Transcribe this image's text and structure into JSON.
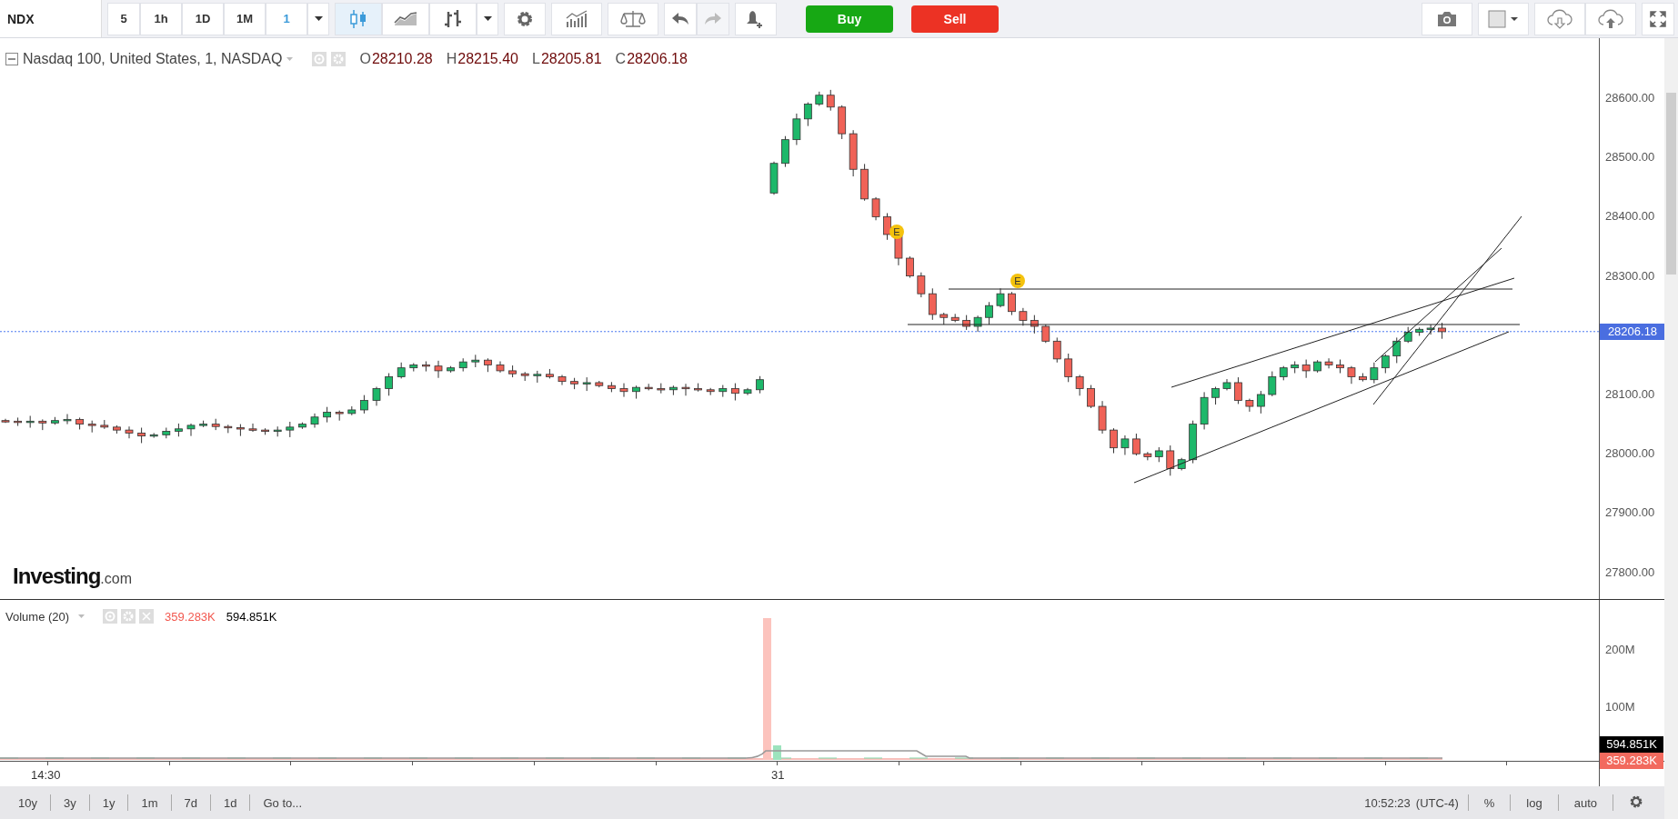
{
  "toolbar": {
    "symbol": "NDX",
    "intervals": [
      {
        "label": "5",
        "selected": false
      },
      {
        "label": "1h",
        "selected": false
      },
      {
        "label": "1D",
        "selected": false
      },
      {
        "label": "1M",
        "selected": false
      },
      {
        "label": "1",
        "selected": true
      }
    ],
    "chart_types": [
      {
        "kind": "candles",
        "selected": true
      },
      {
        "kind": "line",
        "selected": false
      },
      {
        "kind": "bars",
        "selected": false
      }
    ],
    "buy": "Buy",
    "sell": "Sell"
  },
  "legend": {
    "title": "Nasdaq 100, United States, 1, NASDAQ",
    "ohlc": [
      {
        "label": "O",
        "value": "28210.28"
      },
      {
        "label": "H",
        "value": "28215.40"
      },
      {
        "label": "L",
        "value": "28205.81"
      },
      {
        "label": "C",
        "value": "28206.18"
      }
    ]
  },
  "logo": {
    "name": "Investing",
    "suffix": ".com"
  },
  "events": [
    {
      "label": "E"
    },
    {
      "label": "E"
    }
  ],
  "price_axis": {
    "ticks": [
      "28600.00",
      "28500.00",
      "28400.00",
      "28300.00",
      "28100.00",
      "28000.00",
      "27900.00",
      "27800.00"
    ],
    "last_price": "28206.18"
  },
  "volume": {
    "title": "Volume (20)",
    "values": [
      {
        "text": "359.283K",
        "color": "#f2584f"
      },
      {
        "text": "594.851K",
        "color": "#000000"
      }
    ],
    "ticks": [
      "200M",
      "100M"
    ],
    "badges": [
      {
        "text": "594.851K",
        "color": "#000000"
      },
      {
        "text": "359.283K",
        "color": "#f26a5e"
      }
    ]
  },
  "time_axis": {
    "labels": [
      "14:30",
      "31"
    ]
  },
  "bottom_bar": {
    "ranges": [
      "10y",
      "3y",
      "1y",
      "1m",
      "7d",
      "1d"
    ],
    "goto": "Go to...",
    "clock": "10:52:23",
    "timezone": "(UTC-4)",
    "options": [
      "%",
      "log",
      "auto"
    ]
  }
}
